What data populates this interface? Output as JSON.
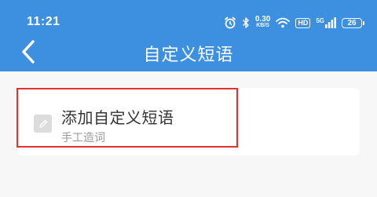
{
  "status_bar": {
    "time": "11:21",
    "net_speed_value": "0.30",
    "net_speed_unit": "KB/S",
    "hd_label": "HD",
    "signal_label": "5G",
    "battery_level": "26",
    "icons": [
      "alarm-icon",
      "bluetooth-icon",
      "wifi-icon",
      "signal-icon",
      "battery-icon"
    ]
  },
  "nav": {
    "title": "自定义短语",
    "back_icon": "chevron-left-icon"
  },
  "list": {
    "items": [
      {
        "icon": "pencil-icon",
        "title": "添加自定义短语",
        "subtitle": "手工造词",
        "highlighted": true
      }
    ]
  },
  "colors": {
    "header_bg": "#3d8fe0",
    "page_bg": "#f7f7f7",
    "highlight_border": "#e53030",
    "title_text": "#333333",
    "subtitle_text": "#999999"
  }
}
